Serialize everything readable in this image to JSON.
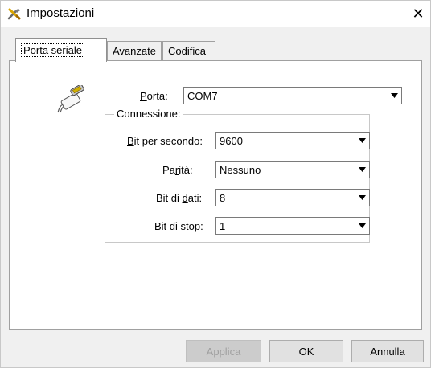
{
  "window": {
    "title": "Impostazioni"
  },
  "tabs": [
    {
      "label": "Porta seriale",
      "active": true
    },
    {
      "label": "Avanzate",
      "active": false
    },
    {
      "label": "Codifica",
      "active": false
    }
  ],
  "port": {
    "label_prefix": "P",
    "label_rest": "orta:",
    "value": "COM7"
  },
  "connection": {
    "group_title": "Connessione:",
    "baud": {
      "label_u": "B",
      "label_rest": "it per secondo:",
      "value": "9600"
    },
    "parity": {
      "label_pre": "Pa",
      "label_u": "r",
      "label_rest": "ità:",
      "value": "Nessuno"
    },
    "data_bits": {
      "label_pre": "Bit di ",
      "label_u": "d",
      "label_rest": "ati:",
      "value": "8"
    },
    "stop_bits": {
      "label_pre": "Bit di ",
      "label_u": "s",
      "label_rest": "top:",
      "value": "1"
    }
  },
  "buttons": {
    "apply": "Applica",
    "ok": "OK",
    "cancel": "Annulla"
  },
  "icons": {
    "title": "settings-tools-icon",
    "port": "serial-cable-icon",
    "close": "close-icon",
    "dropdown": "chevron-down-icon"
  }
}
